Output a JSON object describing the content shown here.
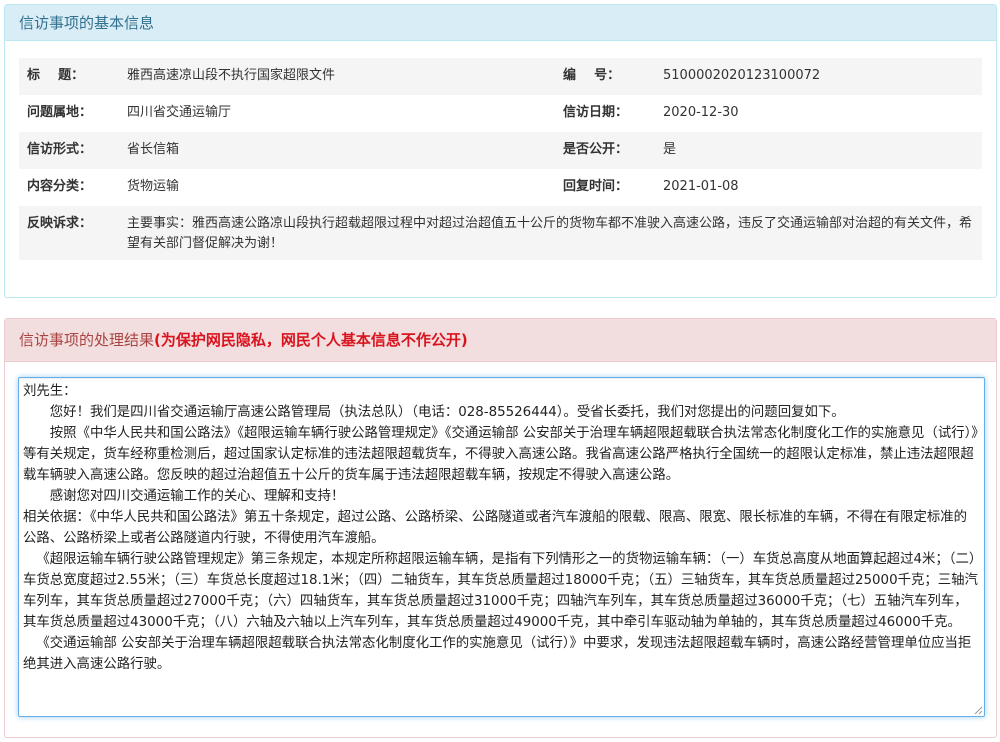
{
  "basic_info": {
    "heading": "信访事项的基本信息",
    "rows": [
      {
        "label1": "标    题：",
        "value1": "雅西高速凉山段不执行国家超限文件",
        "label2": "编    号：",
        "value2": "5100002020123100072"
      },
      {
        "label1": "问题属地：",
        "value1": "四川省交通运输厅",
        "label2": "信访日期：",
        "value2": "2020-12-30"
      },
      {
        "label1": "信访形式：",
        "value1": "省长信箱",
        "label2": "是否公开：",
        "value2": "是"
      },
      {
        "label1": "内容分类：",
        "value1": "货物运输",
        "label2": "回复时间：",
        "value2": "2021-01-08"
      }
    ],
    "complaint_label": "反映诉求：",
    "complaint_text": "主要事实：雅西高速公路凉山段执行超载超限过程中对超过治超值五十公斤的货物车都不准驶入高速公路，违反了交通运输部对治超的有关文件，希望有关部门督促解决为谢！"
  },
  "result": {
    "heading": "信访事项的处理结果",
    "note": "(为保护网民隐私，网民个人基本信息不作公开)",
    "paragraphs": [
      "刘先生：",
      "您好！我们是四川省交通运输厅高速公路管理局（执法总队）（电话：028-85526444）。受省长委托，我们对您提出的问题回复如下。",
      "按照《中华人民共和国公路法》《超限运输车辆行驶公路管理规定》《交通运输部 公安部关于治理车辆超限超载联合执法常态化制度化工作的实施意见（试行）》等有关规定，货车经称重检测后，超过国家认定标准的违法超限超载货车，不得驶入高速公路。我省高速公路严格执行全国统一的超限认定标准，禁止违法超限超载车辆驶入高速公路。您反映的超过治超值五十公斤的货车属于违法超限超载车辆，按规定不得驶入高速公路。",
      "感谢您对四川交通运输工作的关心、理解和支持！",
      "相关依据：《中华人民共和国公路法》第五十条规定，超过公路、公路桥梁、公路隧道或者汽车渡船的限载、限高、限宽、限长标准的车辆，不得在有限定标准的公路、公路桥梁上或者公路隧道内行驶，不得使用汽车渡船。",
      "《超限运输车辆行驶公路管理规定》第三条规定，本规定所称超限运输车辆，是指有下列情形之一的货物运输车辆：（一）车货总高度从地面算起超过4米；（二）车货总宽度超过2.55米；（三）车货总长度超过18.1米；（四）二轴货车，其车货总质量超过18000千克；（五）三轴货车，其车货总质量超过25000千克；三轴汽车列车，其车货总质量超过27000千克；（六）四轴货车，其车货总质量超过31000千克；四轴汽车列车，其车货总质量超过36000千克；（七）五轴汽车列车，其车货总质量超过43000千克；（八）六轴及六轴以上汽车列车，其车货总质量超过49000千克，其中牵引车驱动轴为单轴的，其车货总质量超过46000千克。",
      "《交通运输部 公安部关于治理车辆超限超载联合执法常态化制度化工作的实施意见（试行）》中要求，发现违法超限超载车辆时，高速公路经营管理单位应当拒绝其进入高速公路行驶。"
    ]
  }
}
